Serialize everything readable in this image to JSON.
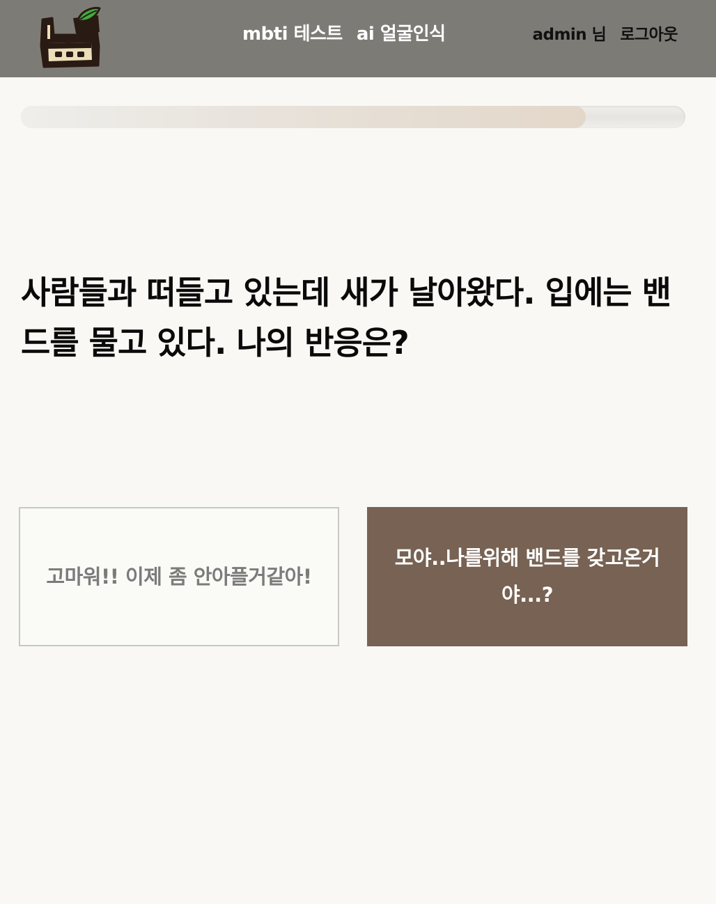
{
  "header": {
    "logo_icon": "leaf-bag-logo-icon",
    "nav": [
      {
        "label": "mbti 테스트"
      },
      {
        "label": "ai 얼굴인식"
      }
    ],
    "user_label": "admin 님",
    "logout_label": "로그아웃"
  },
  "progress": {
    "value_percent": 85
  },
  "question": {
    "text": "사람들과 떠들고 있는데 새가 날아왔다. 입에는 밴드를 물고 있다. 나의 반응은?"
  },
  "answers": [
    {
      "label": "고마워!! 이제 좀 안아플거같아!"
    },
    {
      "label": "모야..나를위해 밴드를 갖고온거야...?"
    }
  ],
  "colors": {
    "header_bg": "#7d7b76",
    "page_bg": "#f9f8f4",
    "answer_selected_bg": "#776253",
    "logo_dark": "#2a1a14",
    "logo_leaf": "#3fae3f",
    "logo_cream": "#ecdfb9"
  }
}
